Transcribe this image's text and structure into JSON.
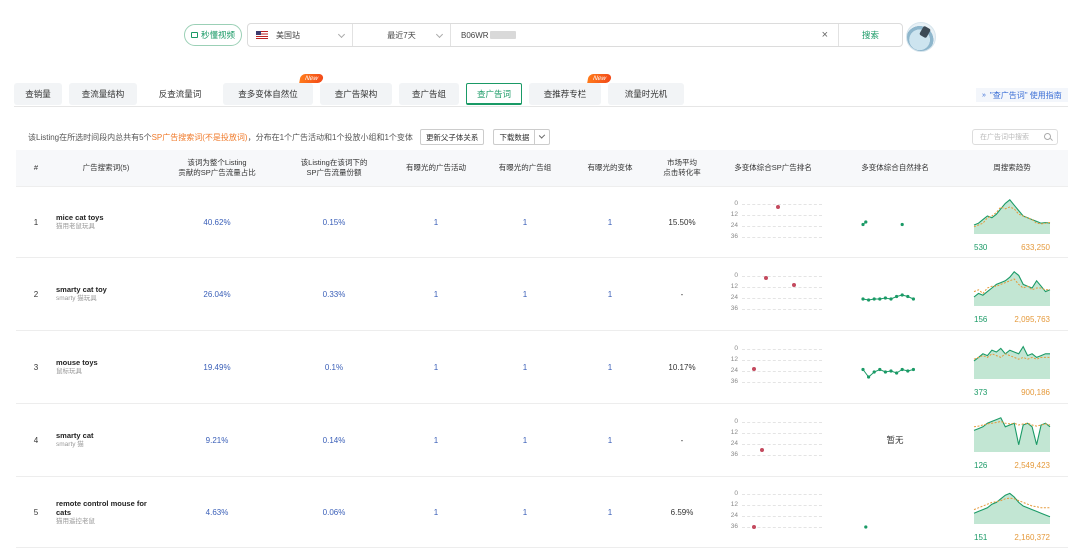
{
  "search": {
    "video_label": "秒懂视频",
    "marketplace": "美国站",
    "date_range": "最近7天",
    "asin": "B06WR",
    "search_button": "搜索"
  },
  "tabs": [
    {
      "label": "查销量",
      "badge": ""
    },
    {
      "label": "查流量结构",
      "badge": ""
    },
    {
      "label": "反查流量词",
      "badge": ""
    },
    {
      "label": "查多变体自然位",
      "badge": "New"
    },
    {
      "label": "查广告架构",
      "badge": ""
    },
    {
      "label": "查广告组",
      "badge": ""
    },
    {
      "label": "查广告词",
      "badge": ""
    },
    {
      "label": "查推荐专栏",
      "badge": "New"
    },
    {
      "label": "流量时光机",
      "badge": ""
    }
  ],
  "active_tab": "查广告词",
  "guide_link": "\"查广告词\" 使用指南",
  "summary": {
    "text_before": "该Listing在所选时间段内总共有5个",
    "highlight": "SP广告搜索词(不是投放词)",
    "text_after": "，分布在1个广告活动和1个投放小组和1个变体",
    "update_button": "更新父子体关系",
    "download_button": "下载数据",
    "search_placeholder": "在广告词中搜索"
  },
  "columns": [
    "#",
    "广告搜索词(5)",
    "该词为整个Listing\n贡献的SP广告流量占比",
    "该Listing在该词下的\nSP广告流量份额",
    "有曝光的广告活动",
    "有曝光的广告组",
    "有曝光的变体",
    "市场平均\n点击转化率",
    "多变体综合SP广告排名",
    "多变体综合自然排名",
    "周搜索趋势"
  ],
  "rank_ticks": [
    "0",
    "12",
    "24",
    "36"
  ],
  "rows": [
    {
      "num": "1",
      "kw_en": "mice cat toys",
      "kw_cn": "猫用老鼠玩具",
      "share_total": "40.62%",
      "share_word": "0.15%",
      "campaigns": "1",
      "groups": "1",
      "variants": "1",
      "cvr": "15.50%",
      "sp_rank": [
        {
          "x": 0.45,
          "y": 3
        }
      ],
      "natural_rank": [
        [
          0,
          0.55
        ],
        [
          0.05,
          0.5
        ]
      ],
      "natural_extra": [
        [
          0.7,
          0.55
        ]
      ],
      "trend": [
        0.25,
        0.3,
        0.4,
        0.5,
        0.45,
        0.55,
        0.7,
        0.85,
        0.95,
        0.8,
        0.65,
        0.5,
        0.45,
        0.4,
        0.35,
        0.3,
        0.32,
        0.3
      ],
      "trend_b": [
        0.2,
        0.25,
        0.3,
        0.45,
        0.5,
        0.6,
        0.75,
        0.7,
        0.75,
        0.7,
        0.55,
        0.5,
        0.45,
        0.4,
        0.3,
        0.28,
        0.3,
        0.32
      ],
      "trend_min": "530",
      "trend_max": "633,250",
      "natural_na": ""
    },
    {
      "num": "2",
      "kw_en": "smarty cat toy",
      "kw_cn": "smarty 猫玩具",
      "share_total": "26.04%",
      "share_word": "0.33%",
      "campaigns": "1",
      "groups": "1",
      "variants": "1",
      "cvr": "-",
      "sp_rank": [
        {
          "x": 0.3,
          "y": 2
        },
        {
          "x": 0.65,
          "y": 10
        }
      ],
      "natural_rank": [
        [
          0,
          0.6
        ],
        [
          0.1,
          0.62
        ],
        [
          0.2,
          0.6
        ],
        [
          0.3,
          0.6
        ],
        [
          0.4,
          0.58
        ],
        [
          0.5,
          0.6
        ],
        [
          0.6,
          0.55
        ],
        [
          0.7,
          0.52
        ],
        [
          0.8,
          0.55
        ],
        [
          0.9,
          0.6
        ]
      ],
      "natural_extra": [],
      "trend": [
        0.25,
        0.35,
        0.3,
        0.4,
        0.5,
        0.6,
        0.65,
        0.7,
        0.8,
        0.95,
        0.85,
        0.6,
        0.55,
        0.5,
        0.7,
        0.55,
        0.4,
        0.45
      ],
      "trend_b": [
        0.4,
        0.45,
        0.35,
        0.5,
        0.55,
        0.55,
        0.6,
        0.65,
        0.7,
        0.75,
        0.6,
        0.5,
        0.55,
        0.45,
        0.5,
        0.5,
        0.45,
        0.45
      ],
      "trend_min": "156",
      "trend_max": "2,095,763",
      "natural_na": ""
    },
    {
      "num": "3",
      "kw_en": "mouse toys",
      "kw_cn": "鼠标玩具",
      "share_total": "19.49%",
      "share_word": "0.1%",
      "campaigns": "1",
      "groups": "1",
      "variants": "1",
      "cvr": "10.17%",
      "sp_rank": [
        {
          "x": 0.15,
          "y": 22
        }
      ],
      "natural_rank": [
        [
          0,
          0.55
        ],
        [
          0.1,
          0.7
        ],
        [
          0.2,
          0.6
        ],
        [
          0.3,
          0.55
        ],
        [
          0.4,
          0.6
        ],
        [
          0.5,
          0.58
        ],
        [
          0.6,
          0.62
        ],
        [
          0.7,
          0.55
        ],
        [
          0.8,
          0.58
        ],
        [
          0.9,
          0.55
        ]
      ],
      "natural_extra": [],
      "trend": [
        0.5,
        0.6,
        0.7,
        0.65,
        0.8,
        0.75,
        0.85,
        0.7,
        0.8,
        0.75,
        0.7,
        0.9,
        0.65,
        0.7,
        0.6,
        0.65,
        0.7,
        0.7
      ],
      "trend_b": [
        0.55,
        0.6,
        0.65,
        0.6,
        0.7,
        0.65,
        0.6,
        0.7,
        0.65,
        0.6,
        0.55,
        0.6,
        0.55,
        0.6,
        0.55,
        0.6,
        0.6,
        0.6
      ],
      "trend_min": "373",
      "trend_max": "900,186",
      "natural_na": ""
    },
    {
      "num": "4",
      "kw_en": "smarty cat",
      "kw_cn": "smarty 猫",
      "share_total": "9.21%",
      "share_word": "0.14%",
      "campaigns": "1",
      "groups": "1",
      "variants": "1",
      "cvr": "-",
      "sp_rank": [
        {
          "x": 0.25,
          "y": 30
        }
      ],
      "natural_rank": [],
      "natural_extra": [],
      "trend": [
        0.6,
        0.65,
        0.7,
        0.8,
        0.85,
        0.9,
        0.95,
        0.7,
        0.75,
        0.8,
        0.2,
        0.75,
        0.8,
        0.7,
        0.2,
        0.75,
        0.8,
        0.7
      ],
      "trend_b": [
        0.7,
        0.72,
        0.75,
        0.78,
        0.8,
        0.82,
        0.85,
        0.8,
        0.78,
        0.8,
        0.75,
        0.78,
        0.8,
        0.75,
        0.72,
        0.75,
        0.78,
        0.75
      ],
      "trend_min": "126",
      "trend_max": "2,549,423",
      "natural_na": "暂无"
    },
    {
      "num": "5",
      "kw_en": "remote control mouse for cats",
      "kw_cn": "猫用遥控老鼠",
      "share_total": "4.63%",
      "share_word": "0.06%",
      "campaigns": "1",
      "groups": "1",
      "variants": "1",
      "cvr": "6.59%",
      "sp_rank": [
        {
          "x": 0.15,
          "y": 36
        }
      ],
      "natural_rank": [],
      "natural_extra": [
        [
          0.05,
          0.8
        ]
      ],
      "trend": [
        0.3,
        0.35,
        0.4,
        0.45,
        0.55,
        0.6,
        0.7,
        0.8,
        0.85,
        0.75,
        0.6,
        0.5,
        0.45,
        0.4,
        0.35,
        0.3,
        0.25,
        0.2
      ],
      "trend_b": [
        0.4,
        0.45,
        0.5,
        0.55,
        0.6,
        0.62,
        0.65,
        0.7,
        0.72,
        0.7,
        0.65,
        0.6,
        0.55,
        0.5,
        0.48,
        0.45,
        0.45,
        0.45
      ],
      "trend_min": "151",
      "trend_max": "2,160,372",
      "natural_na": ""
    }
  ],
  "colors": {
    "accent": "#1a9a66",
    "rank_dot": "#c44a5e",
    "trend_green": "#1a9a66",
    "trend_orange": "#e59a3c",
    "highlight": "#f07a2a",
    "link": "#3a5fb8"
  }
}
